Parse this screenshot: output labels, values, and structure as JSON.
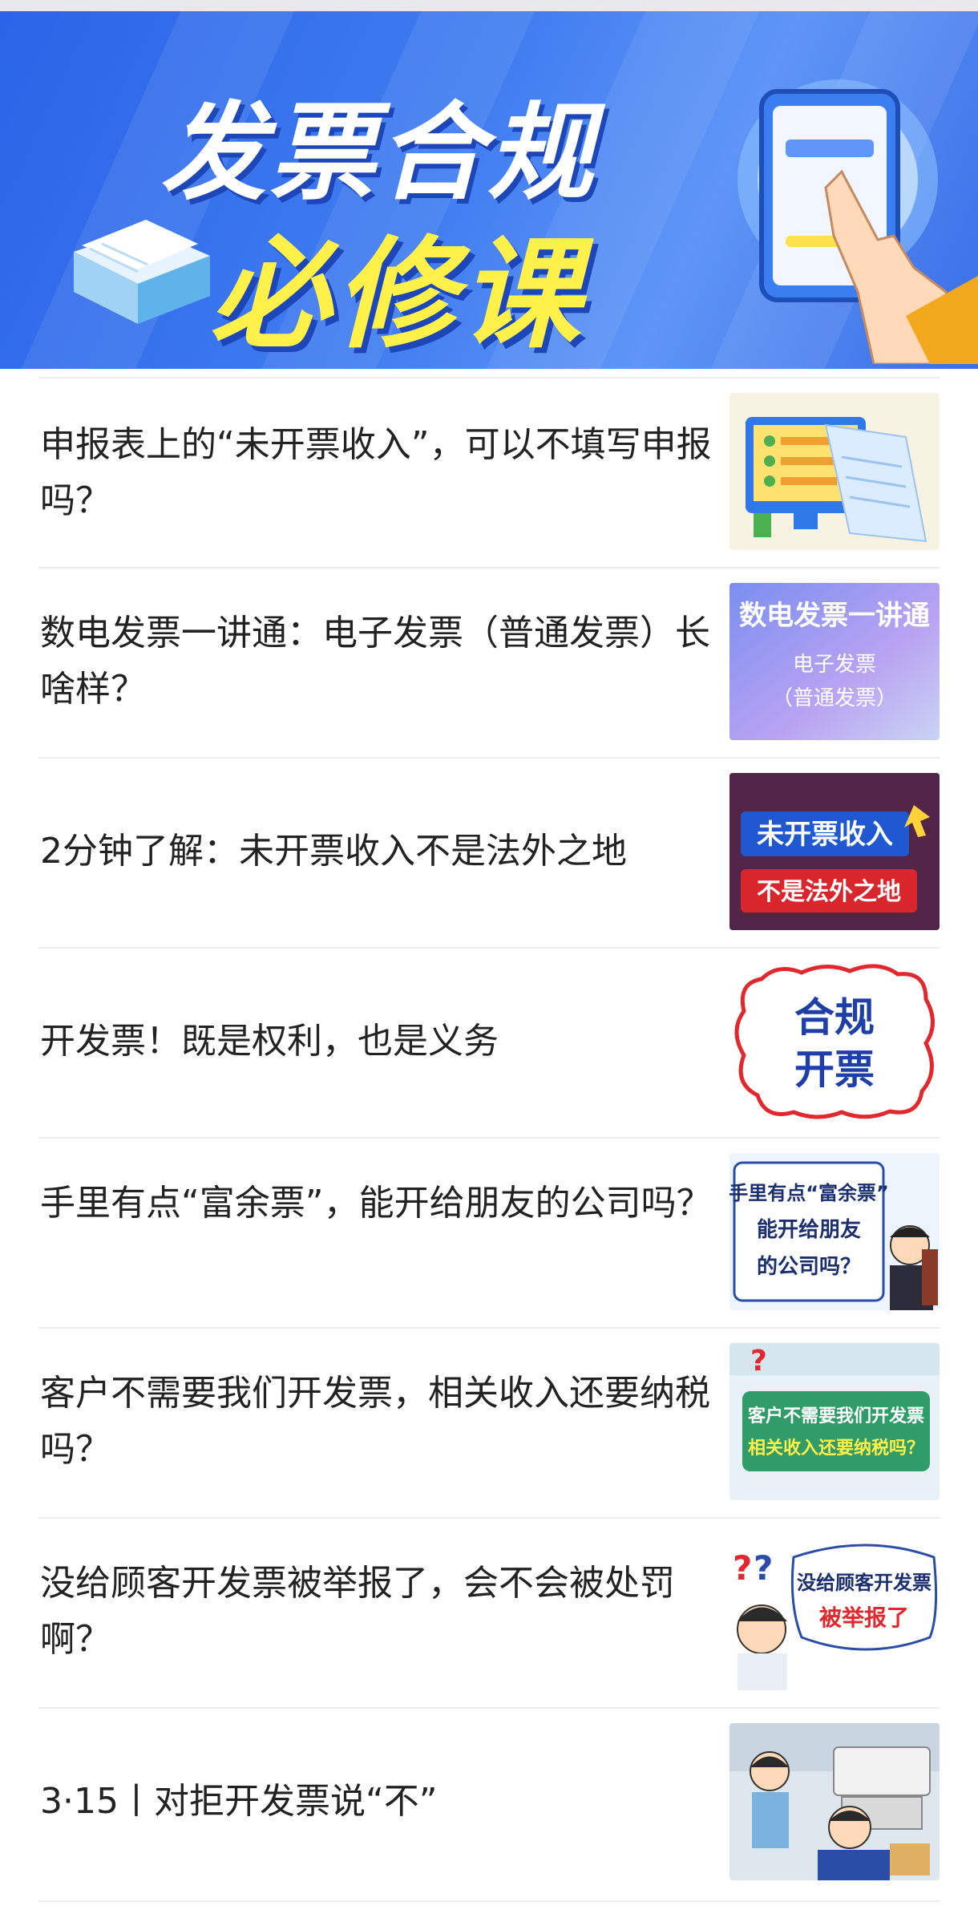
{
  "banner": {
    "title_line1": "发票合规",
    "title_line2": "必修课"
  },
  "articles": [
    {
      "title": "申报表上的“未开票收入”，可以不填写申报吗？",
      "thumb_text": []
    },
    {
      "title": "数电发票一讲通：电子发票（普通发票）长啥样？",
      "thumb_text": [
        "数电发票一讲通",
        "电子发票",
        "（普通发票）"
      ]
    },
    {
      "title": "2分钟了解：未开票收入不是法外之地",
      "thumb_text": [
        "未开票收入",
        "不是法外之地"
      ]
    },
    {
      "title": "开发票！既是权利，也是义务",
      "thumb_text": [
        "合规",
        "开票"
      ]
    },
    {
      "title": "手里有点“富余票”，能开给朋友的公司吗？",
      "thumb_text": [
        "手里有点“富余票”",
        "能开给朋友",
        "的公司吗？"
      ]
    },
    {
      "title": "客户不需要我们开发票，相关收入还要纳税吗？",
      "thumb_text": [
        "客户不需要我们开发票",
        "相关收入还要纳税吗？"
      ]
    },
    {
      "title": "没给顾客开发票被举报了，会不会被处罚啊？",
      "thumb_text": [
        "没给顾客开发票",
        "被举报了"
      ]
    },
    {
      "title": "3·15丨对拒开发票说“不”",
      "thumb_text": []
    }
  ],
  "colors": {
    "banner_blue": "#3f7cf0",
    "title_yellow": "#fff14a",
    "text": "#222222",
    "divider": "#ececec"
  }
}
